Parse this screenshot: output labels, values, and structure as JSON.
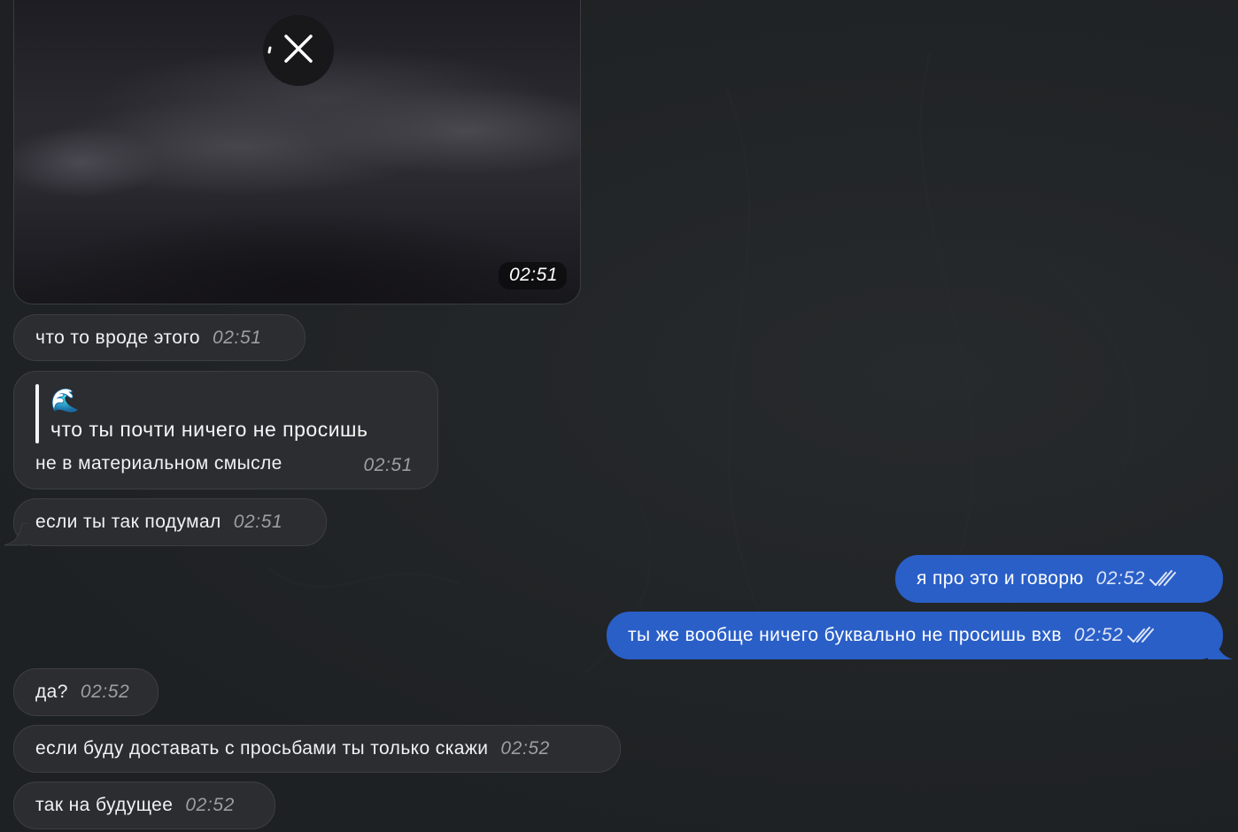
{
  "media": {
    "time": "02:51",
    "close_icon": "close-icon"
  },
  "messages": [
    {
      "text": "что то вроде этого",
      "time": "02:51"
    },
    {
      "reply_emoji": "🌊",
      "reply_text": "что ты почти ничего не просишь",
      "text": "не в материальном смысле",
      "time": "02:51"
    },
    {
      "text": "если ты так подумал",
      "time": "02:51"
    },
    {
      "text": "я про это и говорю",
      "time": "02:52"
    },
    {
      "text": "ты же вообще ничего буквально не просишь вхв",
      "time": "02:52"
    },
    {
      "text": "да?",
      "time": "02:52"
    },
    {
      "text": "если буду доставать с просьбами ты только скажи",
      "time": "02:52"
    },
    {
      "text": "так на будущее",
      "time": "02:52"
    }
  ],
  "colors": {
    "background": "#202325",
    "incoming_bubble": "#2b2d30",
    "outgoing_bubble": "#2a5fc8"
  }
}
